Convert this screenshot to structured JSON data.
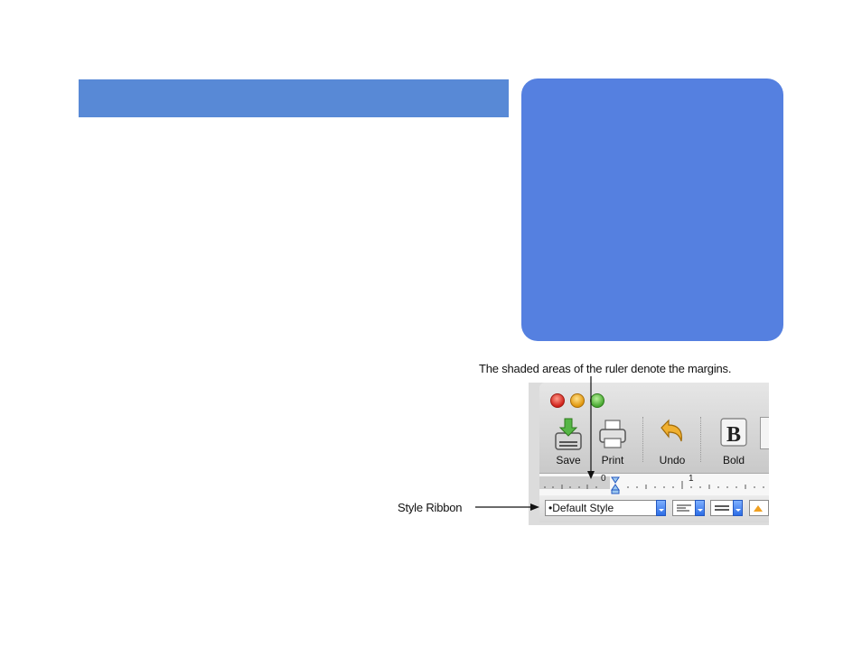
{
  "annotations": {
    "ruler_caption": "The shaded areas of the ruler denote the margins.",
    "ribbon_caption": "Style Ribbon"
  },
  "window": {
    "toolbar": [
      {
        "label": "Save",
        "icon": "save-icon"
      },
      {
        "label": "Print",
        "icon": "printer-icon"
      },
      {
        "label": "Undo",
        "icon": "undo-icon"
      },
      {
        "label": "Bold",
        "icon": "bold-icon"
      }
    ],
    "ruler": {
      "tick_labels": [
        "0",
        "1"
      ]
    },
    "style_ribbon": {
      "style_select": "•Default Style",
      "alignment_icon": "align-left-icon",
      "spacing_icon": "line-spacing-icon",
      "warning_icon": "triangle-icon"
    }
  },
  "colors": {
    "title_bar": "#5889d6",
    "card": "#5580e0",
    "accent_blue": "#2c6de6"
  }
}
